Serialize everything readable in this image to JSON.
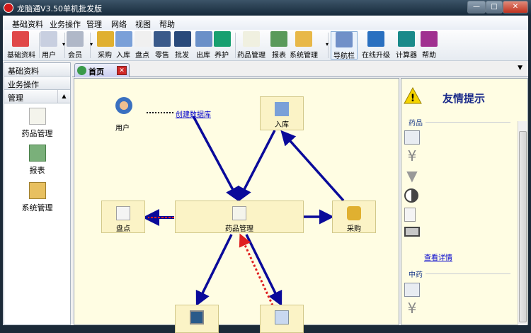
{
  "window": {
    "title": "龙脑通V3.50单机批发版",
    "min": "—",
    "max": "□",
    "close": "✕"
  },
  "menu": [
    "基础资料",
    "业务操作",
    "管理",
    "网络",
    "视图",
    "帮助"
  ],
  "toolbar": [
    {
      "label": "基础资料",
      "icon": "grid-icon",
      "color": "#e04848"
    },
    {
      "label": "用户",
      "icon": "user-card-icon",
      "color": "#c8cfe0"
    },
    {
      "label": "会员",
      "icon": "member-card-icon",
      "color": "#b0b8c8"
    },
    {
      "label": "采购",
      "icon": "purchase-icon",
      "color": "#e0b030"
    },
    {
      "label": "入库",
      "icon": "stock-in-icon",
      "color": "#7aa0d8"
    },
    {
      "label": "盘点",
      "icon": "inventory-icon",
      "color": "#f0f0f0"
    },
    {
      "label": "零售",
      "icon": "retail-monitor-icon",
      "color": "#3a5a8a"
    },
    {
      "label": "批发",
      "icon": "wholesale-monitor-icon",
      "color": "#2a4a7a"
    },
    {
      "label": "出库",
      "icon": "stock-out-icon",
      "color": "#6a90c8"
    },
    {
      "label": "养护",
      "icon": "maintenance-icon",
      "color": "#18a070"
    },
    {
      "label": "药品管理",
      "icon": "drug-management-icon",
      "color": "#f0f0e0"
    },
    {
      "label": "报表",
      "icon": "report-icon",
      "color": "#5a9a5a"
    },
    {
      "label": "系统管理",
      "icon": "system-settings-icon",
      "color": "#e8b848"
    },
    {
      "label": "导航栏",
      "icon": "navigation-icon",
      "color": "#7090c8"
    },
    {
      "label": "在线升级",
      "icon": "online-upgrade-icon",
      "color": "#2a70c0"
    },
    {
      "label": "计算器",
      "icon": "calculator-icon",
      "color": "#1a8a8a"
    },
    {
      "label": "帮助",
      "icon": "help-book-icon",
      "color": "#a03090"
    }
  ],
  "left": {
    "headers": [
      "基础资料",
      "业务操作",
      "管理"
    ],
    "items": [
      "药品管理",
      "报表",
      "系统管理"
    ]
  },
  "tab": {
    "label": "首页",
    "close": "✕"
  },
  "diagram": {
    "user": "用户",
    "create_db": "创建数据库",
    "stock_in": "入库",
    "drug_mgmt": "药品管理",
    "inventory": "盘点",
    "purchase": "采购"
  },
  "tips": {
    "title": "友情提示",
    "section1": "药品",
    "section2": "中药",
    "details": "查看详情"
  },
  "colors": {
    "arrow": "#0a0a9a",
    "dashed": "#e02020",
    "accent": "#1a2a8a"
  }
}
